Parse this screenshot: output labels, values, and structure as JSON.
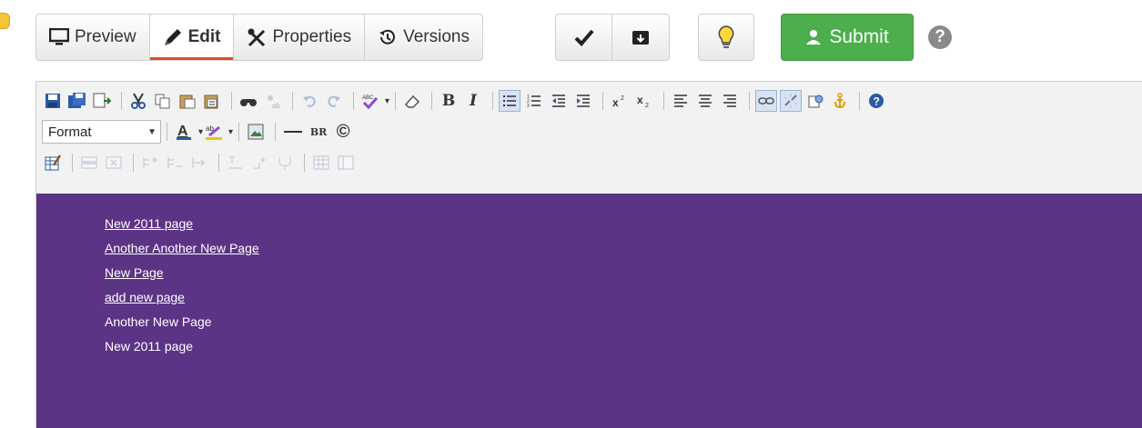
{
  "tabs": {
    "preview": "Preview",
    "edit": "Edit",
    "properties": "Properties",
    "versions": "Versions"
  },
  "actions": {
    "submit": "Submit",
    "help": "?"
  },
  "editor_toolbar": {
    "format_select": "Format",
    "br_label": "BR",
    "copyright_label": "©",
    "bold_label": "B",
    "italic_label": "I"
  },
  "content": {
    "lines": [
      {
        "text": "New 2011 page",
        "link": true
      },
      {
        "text": "Another Another New Page",
        "link": true
      },
      {
        "text": "New Page",
        "link": true
      },
      {
        "text": "add new page",
        "link": true
      },
      {
        "text": "Another New Page",
        "link": false
      },
      {
        "text": "New 2011 page",
        "link": false
      }
    ]
  },
  "colors": {
    "content_background": "#5c3485",
    "submit_green": "#4cae4c",
    "active_tab_underline": "#e04b2c"
  }
}
